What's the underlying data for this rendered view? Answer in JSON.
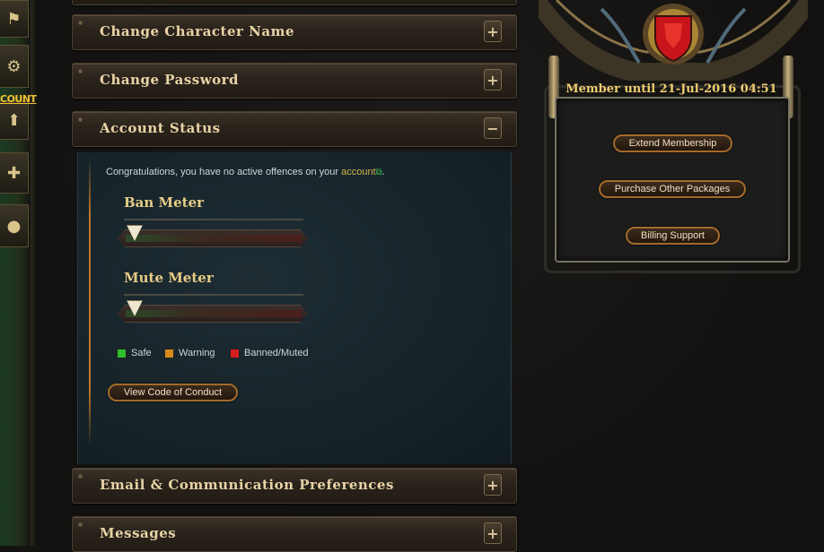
{
  "left_sidebar": {
    "account_label": "COUNT",
    "icons": [
      "flag-icon",
      "gear-icon",
      "account-icon",
      "add-friend-icon",
      "bomb-icon"
    ]
  },
  "sections": [
    {
      "title": "Change Character Name",
      "toggle": "+"
    },
    {
      "title": "Change Password",
      "toggle": "+"
    },
    {
      "title": "Account Status",
      "toggle": "−"
    },
    {
      "title": "Email & Communication Preferences",
      "toggle": "+"
    },
    {
      "title": "Messages",
      "toggle": "+"
    }
  ],
  "account_status": {
    "message_prefix": "Congratulations, you have no active offences on your ",
    "message_link": "account",
    "message_suffix": ".",
    "ban_meter": {
      "title": "Ban Meter",
      "level": 0
    },
    "mute_meter": {
      "title": "Mute Meter",
      "level": 0
    },
    "legend": [
      {
        "label": "Safe",
        "color": "#2fbf2f"
      },
      {
        "label": "Warning",
        "color": "#d98a1c"
      },
      {
        "label": "Banned/Muted",
        "color": "#d42020"
      }
    ],
    "conduct_button": "View Code of Conduct"
  },
  "membership": {
    "status": "Member until 21-Jul-2016 04:51",
    "buttons": [
      "Extend Membership",
      "Purchase Other Packages",
      "Billing Support"
    ]
  },
  "colors": {
    "accent_gold": "#e8d3a6",
    "panel_blue": "#16242a",
    "crest_red": "#c8151b"
  }
}
